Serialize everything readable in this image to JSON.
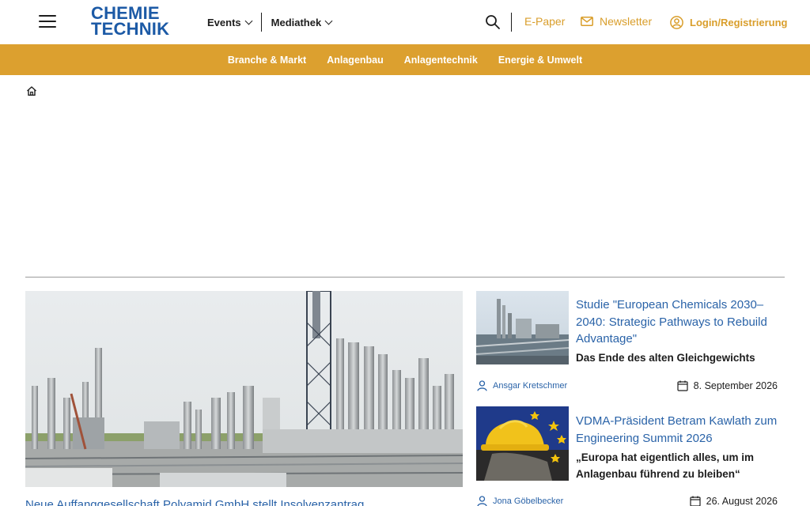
{
  "header": {
    "logo_line1": "CHEMIE",
    "logo_line2": "TECHNIK",
    "nav": [
      {
        "label": "Events"
      },
      {
        "label": "Mediathek"
      }
    ],
    "epaper": "E-Paper",
    "newsletter": "Newsletter",
    "login": "Login/Registrierung"
  },
  "categories": [
    "Branche & Markt",
    "Anlagenbau",
    "Anlagentechnik",
    "Energie & Umwelt"
  ],
  "colors": {
    "brand_blue": "#1c5aa6",
    "accent_gold": "#dca02f",
    "link_blue": "#2a63a8"
  },
  "main": {
    "hero_title": "Neue Auffanggesellschaft Polyamid GmbH stellt Insolvenzantrag"
  },
  "articles": [
    {
      "title": "Studie \"European Chemicals 2030–2040: Strategic Pathways to Rebuild Advantage\"",
      "subtitle": "Das Ende des alten Gleichgewichts",
      "author": "Ansgar Kretschmer",
      "date": "8. September 2026"
    },
    {
      "title": "VDMA-Präsident Betram Kawlath zum Engineering Summit 2026",
      "subtitle": "„Europa hat eigentlich alles, um im Anlagenbau führend zu bleiben“",
      "author": "Jona Göbelbecker",
      "date": "26. August 2026"
    }
  ]
}
